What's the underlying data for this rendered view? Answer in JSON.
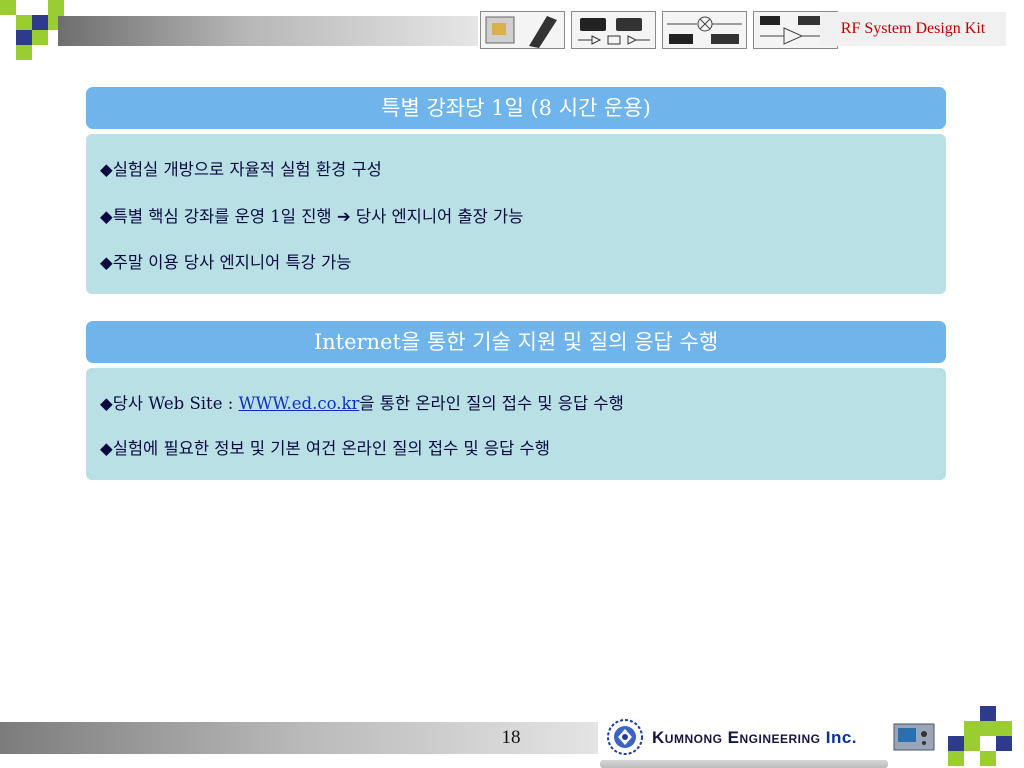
{
  "header": {
    "kit_title": "RF System Design Kit",
    "thumbnails": [
      "rf-module-photo",
      "rf-chip-photo",
      "rf-mixer-schematic",
      "rf-amplifier-schematic"
    ]
  },
  "section1": {
    "title": "특별 강좌당 1일 (8 시간 운용)",
    "items": [
      "◆실험실 개방으로 자율적 실험 환경 구성",
      "◆특별 핵심 강좌를 운영 1일 진행 ➔ 당사 엔지니어 출장 가능",
      "◆주말 이용 당사 엔지니어 특강 가능"
    ]
  },
  "section2": {
    "title": "Internet을 통한 기술 지원 및 질의 응답 수행",
    "item1_prefix": "◆당사 Web Site : ",
    "item1_link": "WWW.ed.co.kr",
    "item1_suffix": "을 통한 온라인 질의 접수 및 응답 수행",
    "item2": "◆실험에 필요한 정보 및 기본 여건 온라인 질의 접수 및 응답 수행"
  },
  "footer": {
    "page_number": "18",
    "company_name": "Kumnong Engineering",
    "company_suffix": "Inc."
  },
  "colors": {
    "accent_blue": "#6fb4ea",
    "panel_teal": "#b9e0e4",
    "checker_green": "#9acd32",
    "checker_navy": "#2e3b8c",
    "kit_title_red": "#c00000"
  }
}
